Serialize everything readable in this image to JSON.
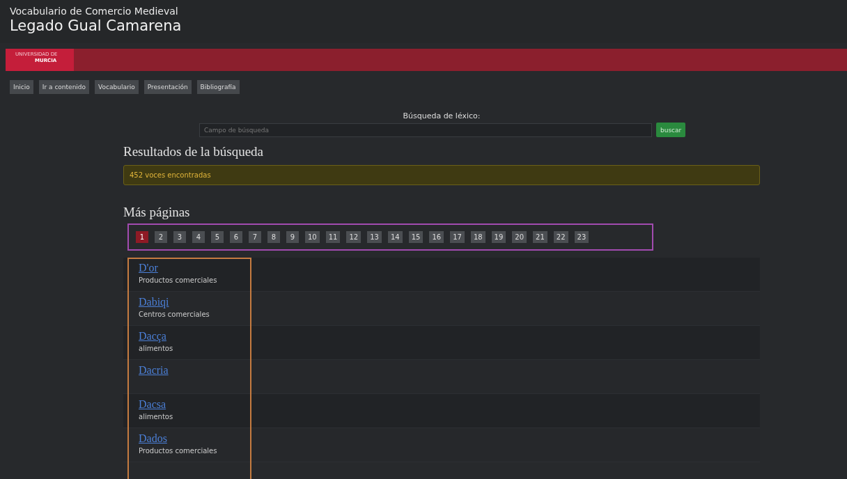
{
  "header": {
    "subtitle": "Vocabulario de Comercio Medieval",
    "title": "Legado Gual Camarena"
  },
  "brand": {
    "line1": "UNIVERSIDAD DE",
    "line2": "MURCIA"
  },
  "nav": [
    "Inicio",
    "Ir a contenido",
    "Vocabulario",
    "Presentación",
    "Bibliografía"
  ],
  "search": {
    "label": "Búsqueda de léxico:",
    "placeholder": "Campo de búsqueda",
    "button": "buscar"
  },
  "results_heading": "Resultados de la búsqueda",
  "alert": "452 voces encontradas",
  "pages_heading": "Más páginas",
  "pages": [
    {
      "label": "1",
      "selected": true
    },
    {
      "label": "2",
      "selected": false
    },
    {
      "label": "3",
      "selected": false
    },
    {
      "label": "4",
      "selected": false
    },
    {
      "label": "5",
      "selected": false
    },
    {
      "label": "6",
      "selected": false
    },
    {
      "label": "7",
      "selected": false
    },
    {
      "label": "8",
      "selected": false
    },
    {
      "label": "9",
      "selected": false
    },
    {
      "label": "10",
      "selected": false
    },
    {
      "label": "11",
      "selected": false
    },
    {
      "label": "12",
      "selected": false
    },
    {
      "label": "13",
      "selected": false
    },
    {
      "label": "14",
      "selected": false
    },
    {
      "label": "15",
      "selected": false
    },
    {
      "label": "16",
      "selected": false
    },
    {
      "label": "17",
      "selected": false
    },
    {
      "label": "18",
      "selected": false
    },
    {
      "label": "19",
      "selected": false
    },
    {
      "label": "20",
      "selected": false
    },
    {
      "label": "21",
      "selected": false
    },
    {
      "label": "22",
      "selected": false
    },
    {
      "label": "23",
      "selected": false
    }
  ],
  "results": [
    {
      "term": "D'or",
      "category": "Productos comerciales"
    },
    {
      "term": "Dabiqi",
      "category": "Centros comerciales"
    },
    {
      "term": "Dacça",
      "category": "alimentos"
    },
    {
      "term": "Dacria"
    },
    {
      "term": "Dacsa",
      "category": "alimentos"
    },
    {
      "term": "Dados",
      "category": "Productos comerciales"
    }
  ]
}
